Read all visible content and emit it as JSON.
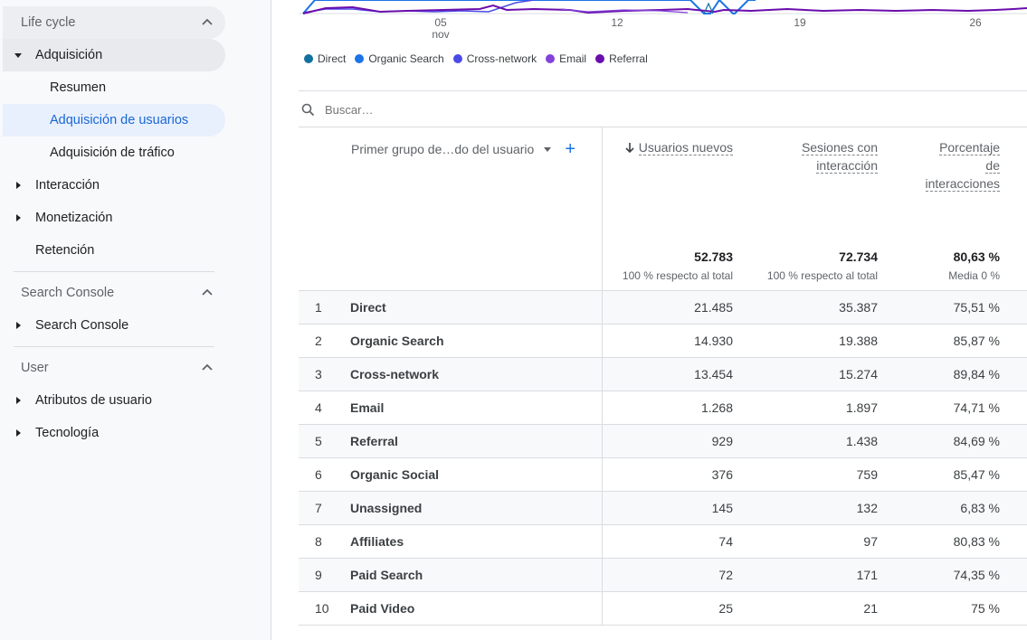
{
  "sidebar": {
    "lifecycle": {
      "title": "Life cycle"
    },
    "acquisition": {
      "label": "Adquisición"
    },
    "acq_items": [
      "Resumen",
      "Adquisición de usuarios",
      "Adquisición de tráfico"
    ],
    "lifecycle_items": [
      "Interacción",
      "Monetización",
      "Retención"
    ],
    "search_console": {
      "title": "Search Console",
      "item": "Search Console"
    },
    "user": {
      "title": "User",
      "items": [
        "Atributos de usuario",
        "Tecnología"
      ]
    }
  },
  "chart": {
    "x_ticks": [
      {
        "day": "05",
        "month": "nov"
      },
      {
        "day": "12",
        "month": ""
      },
      {
        "day": "19",
        "month": ""
      },
      {
        "day": "26",
        "month": ""
      }
    ],
    "legend": [
      {
        "name": "Direct",
        "color": "#12709e"
      },
      {
        "name": "Organic Search",
        "color": "#1a73e8"
      },
      {
        "name": "Cross-network",
        "color": "#4c4ae6"
      },
      {
        "name": "Email",
        "color": "#8342d8"
      },
      {
        "name": "Referral",
        "color": "#6a0dad"
      }
    ]
  },
  "search": {
    "placeholder": "Buscar…"
  },
  "table": {
    "dimension_header": "Primer grupo de…do del usuario",
    "columns": [
      {
        "line1": "Usuarios nuevos",
        "line2": "",
        "line3": "",
        "sorted": true,
        "total": "52.783",
        "total_sub": "100 % respecto al total"
      },
      {
        "line1": "Sesiones con",
        "line2": "interacción",
        "line3": "",
        "sorted": false,
        "total": "72.734",
        "total_sub": "100 % respecto al total"
      },
      {
        "line1": "Porcentaje",
        "line2": "de",
        "line3": "interacciones",
        "sorted": false,
        "total": "80,63 %",
        "total_sub": "Media 0 %"
      }
    ],
    "rows": [
      {
        "idx": "1",
        "name": "Direct",
        "v1": "21.485",
        "v2": "35.387",
        "v3": "75,51 %"
      },
      {
        "idx": "2",
        "name": "Organic Search",
        "v1": "14.930",
        "v2": "19.388",
        "v3": "85,87 %"
      },
      {
        "idx": "3",
        "name": "Cross-network",
        "v1": "13.454",
        "v2": "15.274",
        "v3": "89,84 %"
      },
      {
        "idx": "4",
        "name": "Email",
        "v1": "1.268",
        "v2": "1.897",
        "v3": "74,71 %"
      },
      {
        "idx": "5",
        "name": "Referral",
        "v1": "929",
        "v2": "1.438",
        "v3": "84,69 %"
      },
      {
        "idx": "6",
        "name": "Organic Social",
        "v1": "376",
        "v2": "759",
        "v3": "85,47 %"
      },
      {
        "idx": "7",
        "name": "Unassigned",
        "v1": "145",
        "v2": "132",
        "v3": "6,83 %"
      },
      {
        "idx": "8",
        "name": "Affiliates",
        "v1": "74",
        "v2": "97",
        "v3": "80,83 %"
      },
      {
        "idx": "9",
        "name": "Paid Search",
        "v1": "72",
        "v2": "171",
        "v3": "74,35 %"
      },
      {
        "idx": "10",
        "name": "Paid Video",
        "v1": "25",
        "v2": "21",
        "v3": "75 %"
      }
    ]
  }
}
